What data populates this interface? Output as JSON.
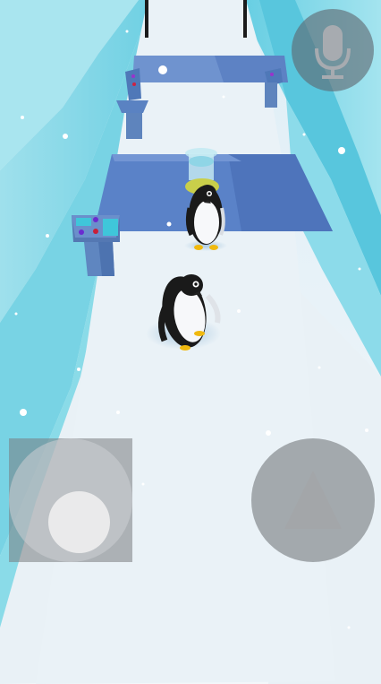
{
  "game": {
    "scene": "ice-bridge-penguin-level",
    "characters": [
      "penguin-player",
      "penguin-npc"
    ]
  },
  "controls": {
    "mic_icon": "microphone-icon",
    "joystick_icon": "joystick-knob",
    "jump_icon": "triangle-up-icon"
  },
  "colors": {
    "ice_wall": "#7dd6e6",
    "floor": "#e7eff5",
    "panel_shadow": "#4a6fb8",
    "button_overlay": "#6a7078"
  }
}
